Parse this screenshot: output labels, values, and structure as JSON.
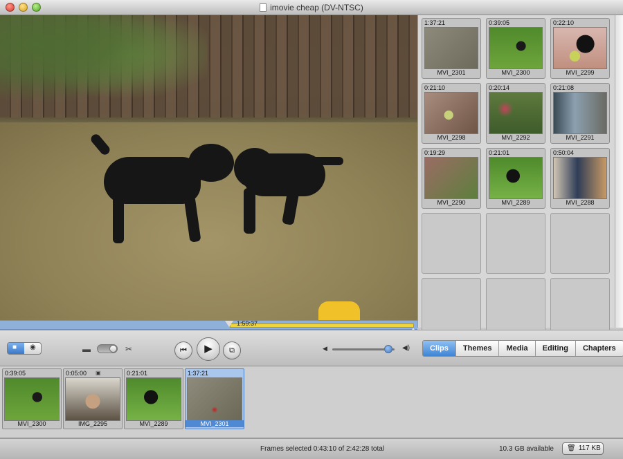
{
  "window": {
    "title": "imovie cheap (DV-NTSC)"
  },
  "viewer": {
    "playhead_time": "1:59:37"
  },
  "clip_panel": {
    "clips": [
      {
        "duration": "1:37:21",
        "name": "MVI_2301",
        "thumb": "gravel"
      },
      {
        "duration": "0:39:05",
        "name": "MVI_2300",
        "thumb": "lawn"
      },
      {
        "duration": "0:22:10",
        "name": "MVI_2299",
        "thumb": "dogball"
      },
      {
        "duration": "0:21:10",
        "name": "MVI_2298",
        "thumb": "hand"
      },
      {
        "duration": "0:20:14",
        "name": "MVI_2292",
        "thumb": "flowers"
      },
      {
        "duration": "0:21:08",
        "name": "MVI_2291",
        "thumb": "porch"
      },
      {
        "duration": "0:19:29",
        "name": "MVI_2290",
        "thumb": "bricks"
      },
      {
        "duration": "0:21:01",
        "name": "MVI_2289",
        "thumb": "grassdog"
      },
      {
        "duration": "0:50:04",
        "name": "MVI_2288",
        "thumb": "legs"
      }
    ],
    "empty_slots": 6
  },
  "controls": {
    "mode_camera_icon": "camera-mode-icon",
    "mode_edit_icon": "edit-mode-icon",
    "rewind_glyph": "⏮",
    "play_glyph": "▶",
    "fullscreen_glyph": "⧉",
    "volume_level": 0.9,
    "tabs": [
      {
        "label": "Clips",
        "active": true
      },
      {
        "label": "Themes",
        "active": false
      },
      {
        "label": "Media",
        "active": false
      },
      {
        "label": "Editing",
        "active": false
      },
      {
        "label": "Chapters",
        "active": false
      }
    ]
  },
  "timeline": {
    "clips": [
      {
        "duration": "0:39:05",
        "name": "MVI_2300",
        "thumb": "lawn",
        "selected": false,
        "camera": false
      },
      {
        "duration": "0:05:00",
        "name": "IMG_2295",
        "thumb": "face",
        "selected": false,
        "camera": true
      },
      {
        "duration": "0:21:01",
        "name": "MVI_2289",
        "thumb": "grassdog",
        "selected": false,
        "camera": false
      },
      {
        "duration": "1:37:21",
        "name": "MVI_2301",
        "thumb": "gravel-red",
        "selected": true,
        "camera": false
      }
    ]
  },
  "status": {
    "frames_text": "Frames selected  0:43:10 of 2:42:28 total",
    "space_text": "10.3 GB available",
    "trash_label": "117 KB"
  },
  "colors": {
    "accent": "#3f84d5",
    "scrub_range": "#f1d63b"
  }
}
